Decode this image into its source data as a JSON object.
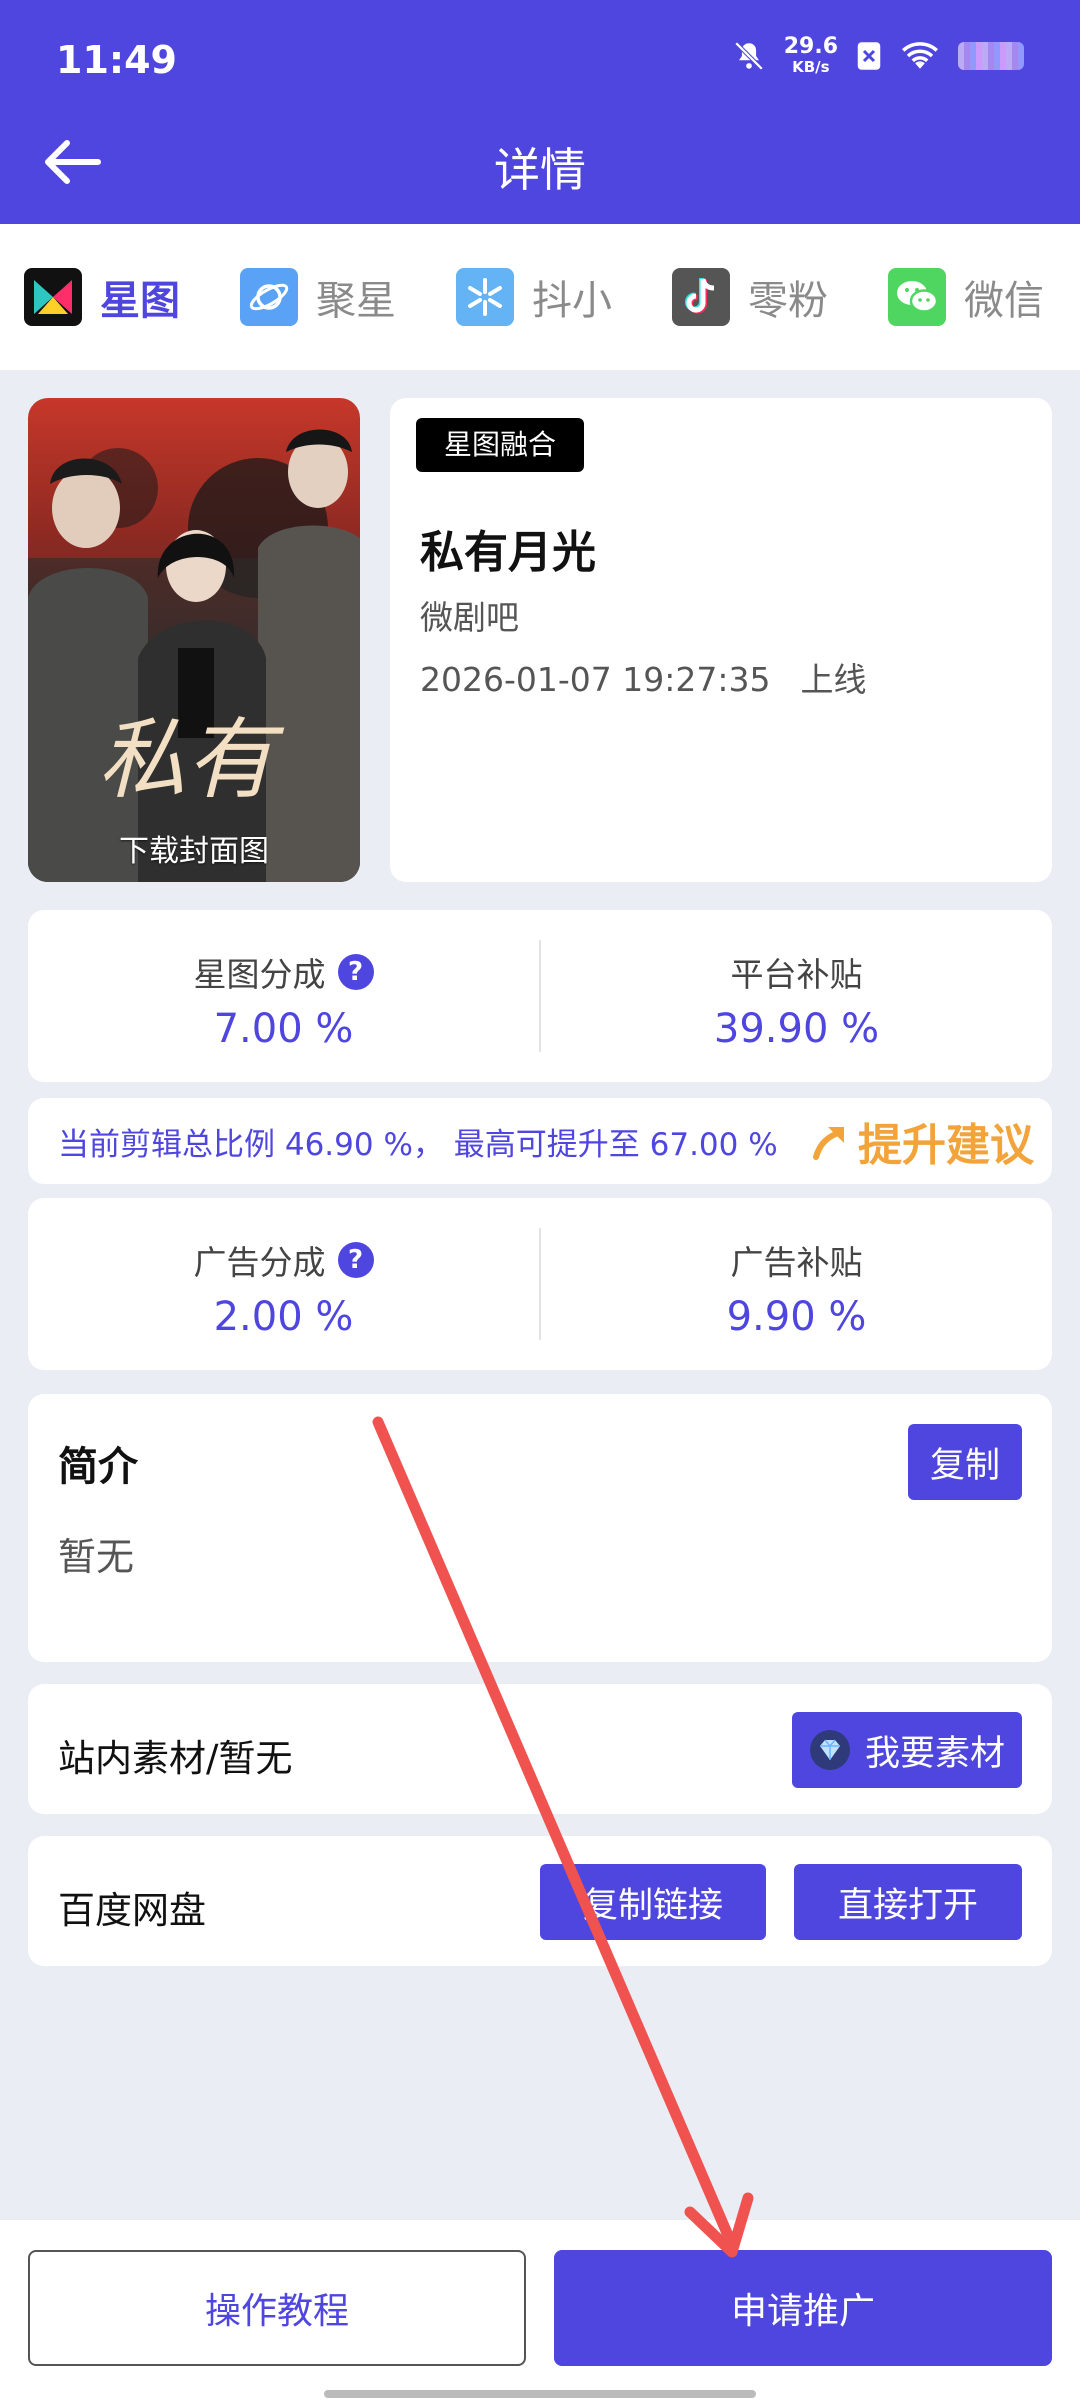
{
  "status_bar": {
    "time": "11:49",
    "speed_value": "29.6",
    "speed_unit": "KB/s"
  },
  "header": {
    "title": "详情"
  },
  "tabs": [
    {
      "label": "星图",
      "active": true,
      "icon": "xingtu-logo-icon"
    },
    {
      "label": "聚星",
      "active": false,
      "icon": "planet-icon"
    },
    {
      "label": "抖小",
      "active": false,
      "icon": "snowflake-icon"
    },
    {
      "label": "零粉",
      "active": false,
      "icon": "tiktok-icon"
    },
    {
      "label": "微信",
      "active": false,
      "icon": "wechat-icon"
    }
  ],
  "drama": {
    "poster_caption": "下载封面图",
    "poster_title_art": "私有",
    "tag": "星图融合",
    "title": "私有月光",
    "producer": "微剧吧",
    "online_time": "2026-01-07 19:27:35",
    "online_label": "上线"
  },
  "stats_primary": {
    "left_label": "星图分成",
    "left_value": "7.00 %",
    "right_label": "平台补贴",
    "right_value": "39.90 %"
  },
  "tip": {
    "text": "当前剪辑总比例 46.90 %， 最高可提升至 67.00 %",
    "link": "提升建议"
  },
  "stats_ads": {
    "left_label": "广告分成",
    "left_value": "2.00 %",
    "right_label": "广告补贴",
    "right_value": "9.90 %"
  },
  "intro": {
    "title": "简介",
    "body": "暂无",
    "copy_button": "复制"
  },
  "materials": {
    "label": "站内素材/暂无",
    "button": "我要素材"
  },
  "netdisk": {
    "label": "百度网盘",
    "copy_link_button": "复制链接",
    "open_button": "直接打开"
  },
  "bottom": {
    "tutorial_button": "操作教程",
    "apply_button": "申请推广"
  },
  "colors": {
    "primary": "#4f46e0",
    "accent_orange": "#f2a33a",
    "annotation_arrow": "#f0524f"
  }
}
